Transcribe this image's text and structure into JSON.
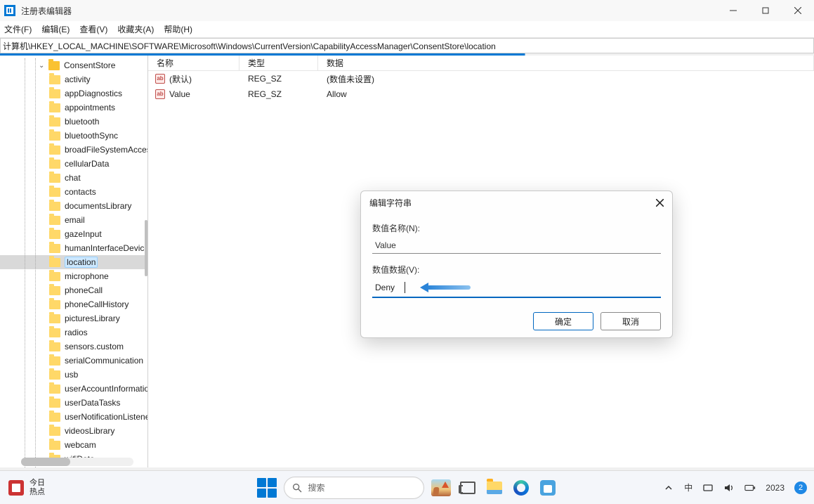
{
  "window": {
    "title": "注册表编辑器"
  },
  "menu": {
    "file": "文件(F)",
    "edit": "编辑(E)",
    "view": "查看(V)",
    "favorites": "收藏夹(A)",
    "help": "帮助(H)"
  },
  "address": "计算机\\HKEY_LOCAL_MACHINE\\SOFTWARE\\Microsoft\\Windows\\CurrentVersion\\CapabilityAccessManager\\ConsentStore\\location",
  "tree": {
    "parent": "ConsentStore",
    "items": [
      "activity",
      "appDiagnostics",
      "appointments",
      "bluetooth",
      "bluetoothSync",
      "broadFileSystemAccess",
      "cellularData",
      "chat",
      "contacts",
      "documentsLibrary",
      "email",
      "gazeInput",
      "humanInterfaceDevice",
      "location",
      "microphone",
      "phoneCall",
      "phoneCallHistory",
      "picturesLibrary",
      "radios",
      "sensors.custom",
      "serialCommunication",
      "usb",
      "userAccountInformation",
      "userDataTasks",
      "userNotificationListener",
      "videosLibrary",
      "webcam",
      "wifiData"
    ],
    "selected": "location"
  },
  "list": {
    "columns": {
      "name": "名称",
      "type": "类型",
      "data": "数据"
    },
    "rows": [
      {
        "name": "(默认)",
        "type": "REG_SZ",
        "data": "(数值未设置)"
      },
      {
        "name": "Value",
        "type": "REG_SZ",
        "data": "Allow"
      }
    ]
  },
  "dialog": {
    "title": "编辑字符串",
    "name_label": "数值名称(N):",
    "name_value": "Value",
    "data_label": "数值数据(V):",
    "data_value": "Deny",
    "ok": "确定",
    "cancel": "取消"
  },
  "taskbar": {
    "news_line1": "今日",
    "news_line2": "热点",
    "search_placeholder": "搜索",
    "ime": "中",
    "clock": "2023",
    "badge": "2"
  }
}
